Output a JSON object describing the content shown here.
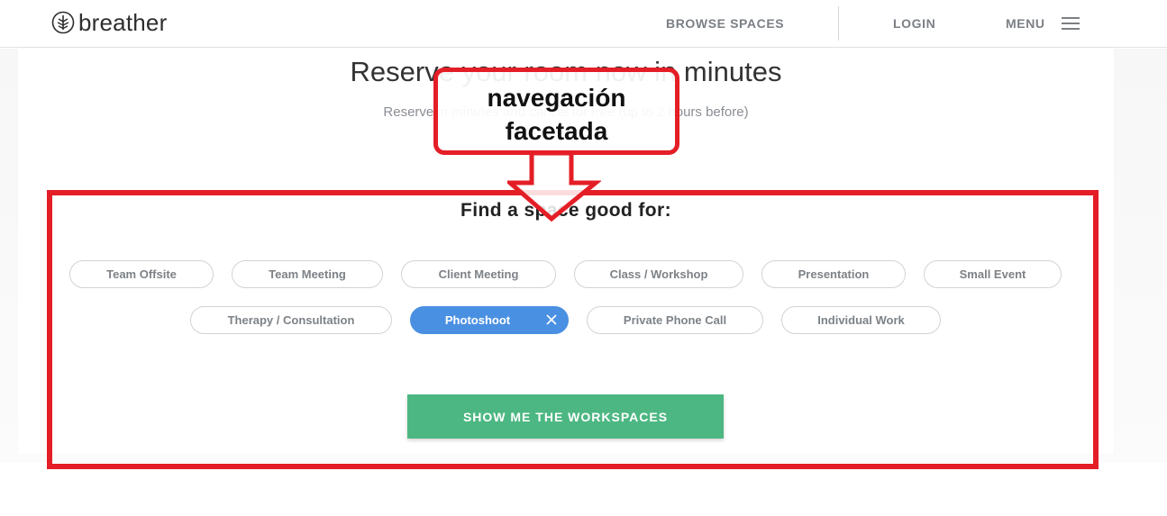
{
  "header": {
    "brand": "breather",
    "nav": {
      "browse": "BROWSE SPACES",
      "login": "LOGIN",
      "menu": "MENU"
    }
  },
  "hero": {
    "title": "Reserve your room now in minutes",
    "subtitle": "Reserve in minutes and cancel for free (up to 2 hours before)"
  },
  "callout": {
    "line1": "navegación",
    "line2": "facetada"
  },
  "facets": {
    "title": "Find a space good for:",
    "options": [
      {
        "label": "Team Offsite",
        "selected": false
      },
      {
        "label": "Team Meeting",
        "selected": false
      },
      {
        "label": "Client Meeting",
        "selected": false
      },
      {
        "label": "Class / Workshop",
        "selected": false
      },
      {
        "label": "Presentation",
        "selected": false
      },
      {
        "label": "Small Event",
        "selected": false
      },
      {
        "label": "Therapy / Consultation",
        "selected": false
      },
      {
        "label": "Photoshoot",
        "selected": true
      },
      {
        "label": "Private Phone Call",
        "selected": false
      },
      {
        "label": "Individual Work",
        "selected": false
      }
    ],
    "cta": "SHOW ME THE WORKSPACES"
  },
  "colors": {
    "accent_red": "#e41e26",
    "selected_blue": "#4a90e2",
    "cta_green": "#4cb782"
  }
}
